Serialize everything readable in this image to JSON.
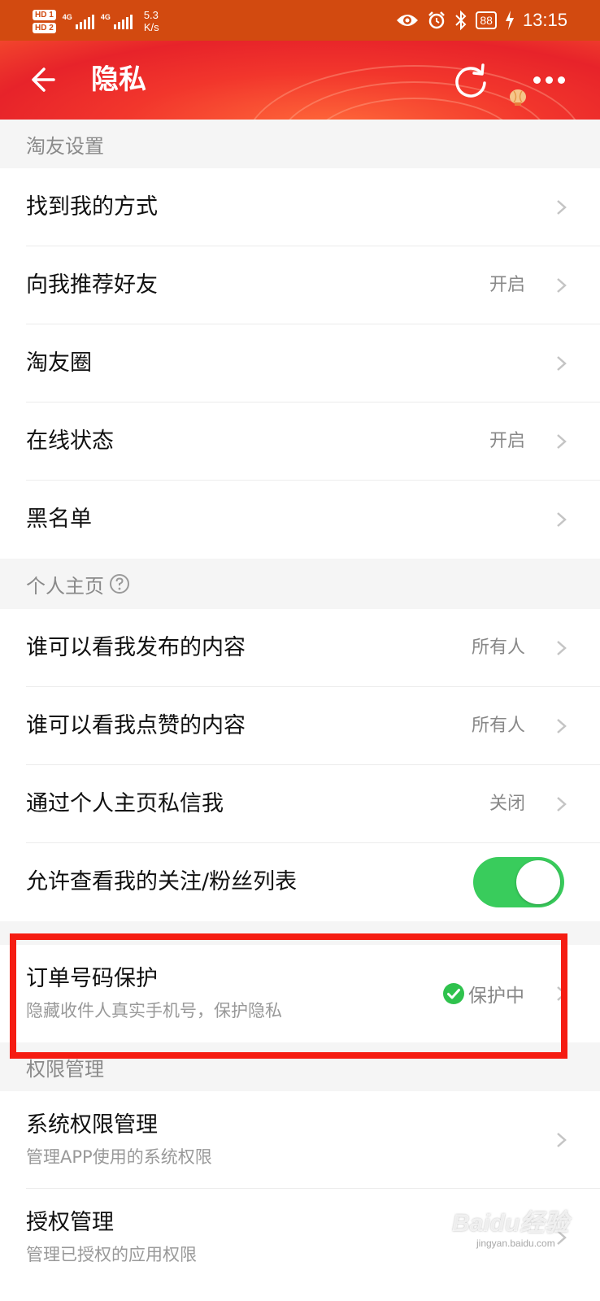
{
  "status_bar": {
    "sim1": "HD 1",
    "sim2": "HD 2",
    "network1": "4G",
    "network2": "4G",
    "speed_value": "5.3",
    "speed_unit": "K/s",
    "battery": "88",
    "time": "13:15",
    "icons": [
      "eye-icon",
      "alarm-icon",
      "bluetooth-icon",
      "battery-icon",
      "charging-icon"
    ]
  },
  "header": {
    "title": "隐私",
    "icons": [
      "back-arrow-icon",
      "refresh-icon",
      "lantern-icon",
      "more-icon"
    ]
  },
  "sections": {
    "friends": {
      "title": "淘友设置",
      "items": [
        {
          "label": "找到我的方式",
          "value": ""
        },
        {
          "label": "向我推荐好友",
          "value": "开启"
        },
        {
          "label": "淘友圈",
          "value": ""
        },
        {
          "label": "在线状态",
          "value": "开启"
        },
        {
          "label": "黑名单",
          "value": ""
        }
      ]
    },
    "homepage": {
      "title": "个人主页",
      "items": [
        {
          "label": "谁可以看我发布的内容",
          "value": "所有人"
        },
        {
          "label": "谁可以看我点赞的内容",
          "value": "所有人"
        },
        {
          "label": "通过个人主页私信我",
          "value": "关闭"
        },
        {
          "label": "允许查看我的关注/粉丝列表",
          "toggle_on": true
        }
      ]
    },
    "order_protect": {
      "label": "订单号码保护",
      "sub": "隐藏收件人真实手机号，保护隐私",
      "status": "保护中"
    },
    "permissions": {
      "title": "权限管理",
      "items": [
        {
          "label": "系统权限管理",
          "sub": "管理APP使用的系统权限"
        },
        {
          "label": "授权管理",
          "sub": "管理已授权的应用权限"
        }
      ]
    }
  },
  "watermark": {
    "logo": "Baidu经验",
    "sub": "jingyan.baidu.com"
  },
  "colors": {
    "status_bar": "#d24a10",
    "header": "#e7232a",
    "toggle": "#39cc5c",
    "highlight": "#f51c12",
    "check": "#2fc24d"
  }
}
